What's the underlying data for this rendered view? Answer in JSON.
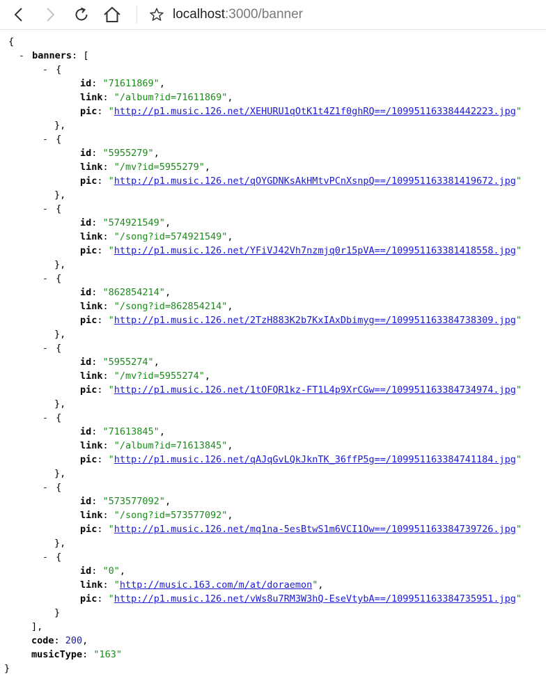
{
  "browser": {
    "address_host": "localhost",
    "address_rest": ":3000/banner"
  },
  "json": {
    "open_brace": "{",
    "close_brace": "}",
    "banners_key": "banners",
    "array_open": "[",
    "array_close": "],",
    "toggle_symbol": "-",
    "item_open": "{",
    "item_close": "},",
    "last_item_close": "}",
    "id_key": "id",
    "link_key": "link",
    "pic_key": "pic",
    "code_key": "code",
    "code_value": "200",
    "musicType_key": "musicType",
    "musicType_value": "\"163\"",
    "banners": [
      {
        "id": "\"71611869\"",
        "link": "\"/album?id=71611869\"",
        "link_is_url": false,
        "pic": "http://p1.music.126.net/XEHURU1qOtK1t4Z1f0ghRQ==/109951163384442223.jpg"
      },
      {
        "id": "\"5955279\"",
        "link": "\"/mv?id=5955279\"",
        "link_is_url": false,
        "pic": "http://p1.music.126.net/qOYGDNKsAkHMtvPCnXsnpQ==/109951163381419672.jpg"
      },
      {
        "id": "\"574921549\"",
        "link": "\"/song?id=574921549\"",
        "link_is_url": false,
        "pic": "http://p1.music.126.net/YFiVJ42Vh7nzmjq0r15pVA==/109951163381418558.jpg"
      },
      {
        "id": "\"862854214\"",
        "link": "\"/song?id=862854214\"",
        "link_is_url": false,
        "pic": "http://p1.music.126.net/2TzH883K2b7KxIAxDbimyg==/109951163384738309.jpg"
      },
      {
        "id": "\"5955274\"",
        "link": "\"/mv?id=5955274\"",
        "link_is_url": false,
        "pic": "http://p1.music.126.net/1tOFQR1kz-FT1L4p9XrCGw==/109951163384734974.jpg"
      },
      {
        "id": "\"71613845\"",
        "link": "\"/album?id=71613845\"",
        "link_is_url": false,
        "pic": "http://p1.music.126.net/qAJqGvLQkJknTK_36ffP5g==/109951163384741184.jpg"
      },
      {
        "id": "\"573577092\"",
        "link": "\"/song?id=573577092\"",
        "link_is_url": false,
        "pic": "http://p1.music.126.net/mq1na-5esBtwS1m6VCI1Ow==/109951163384739726.jpg"
      },
      {
        "id": "\"0\"",
        "link": "http://music.163.com/m/at/doraemon",
        "link_is_url": true,
        "pic": "http://p1.music.126.net/vWs8u7RM3W3hQ-EseVtybA==/109951163384735951.jpg"
      }
    ]
  },
  "colors": {
    "string": "#1c8a1c",
    "number": "#1a1aa6",
    "url": "#1a1ad6"
  },
  "icons": {
    "back": "back-arrow-icon",
    "forward": "forward-arrow-icon",
    "reload": "reload-icon",
    "home": "home-icon",
    "favorite": "star-icon"
  }
}
